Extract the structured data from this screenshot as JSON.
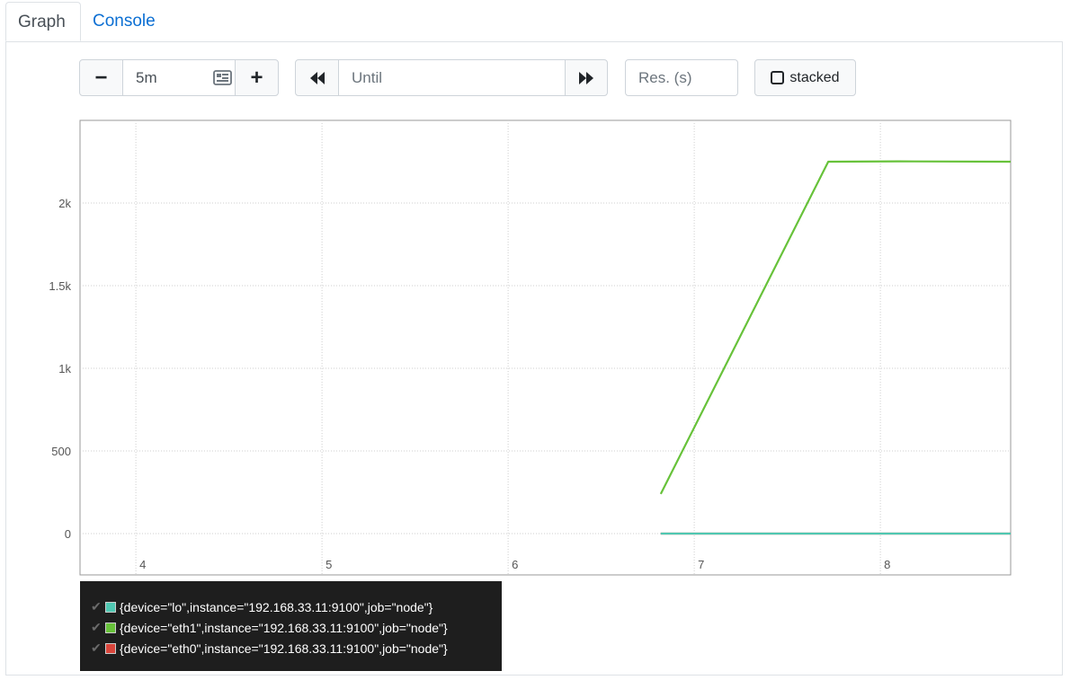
{
  "tabs": [
    {
      "label": "Graph",
      "active": true
    },
    {
      "label": "Console",
      "active": false
    }
  ],
  "controls": {
    "range_minus": "−",
    "range_value": "5m",
    "range_plus": "+",
    "back_icon": "double-left-arrow",
    "until_placeholder": "Until",
    "forward_icon": "double-right-arrow",
    "resolution_placeholder": "Res. (s)",
    "stacked_label": "stacked"
  },
  "chart_data": {
    "type": "line",
    "x_ticks": [
      "4",
      "5",
      "6",
      "7",
      "8"
    ],
    "x_tick_positions": [
      4,
      5,
      6,
      7,
      8
    ],
    "y_ticks": [
      "0",
      "500",
      "1k",
      "1.5k",
      "2k"
    ],
    "y_tick_values": [
      0,
      500,
      1000,
      1500,
      2000
    ],
    "xlim": [
      3.7,
      8.7
    ],
    "ylim": [
      -250,
      2500
    ],
    "grid": true,
    "legend_placement": "bottom-left",
    "series": [
      {
        "name": "{device=\"lo\",instance=\"192.168.33.11:9100\",job=\"node\"}",
        "color": "#4fc7b1",
        "x": [
          6.82,
          8.7
        ],
        "y": [
          0,
          0
        ]
      },
      {
        "name": "{device=\"eth1\",instance=\"192.168.33.11:9100\",job=\"node\"}",
        "color": "#67c23a",
        "x": [
          6.82,
          7.72,
          8.1,
          8.7
        ],
        "y": [
          240,
          2250,
          2252,
          2250
        ]
      },
      {
        "name": "{device=\"eth0\",instance=\"192.168.33.11:9100\",job=\"node\"}",
        "color": "#d9453b",
        "x": [
          6.82,
          8.7
        ],
        "y": [
          0,
          0
        ]
      }
    ]
  }
}
